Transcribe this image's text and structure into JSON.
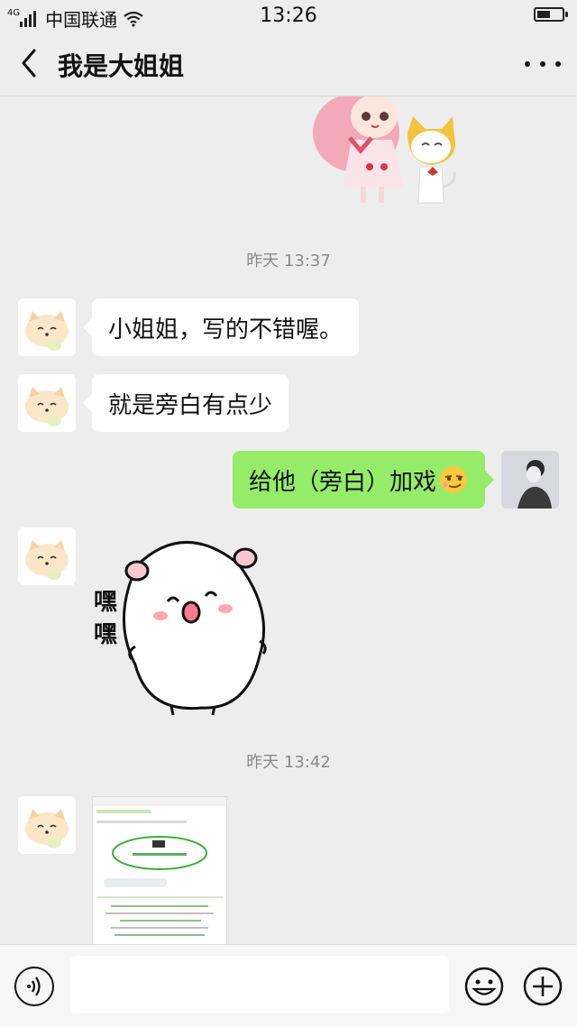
{
  "status": {
    "carrier": "中国联通",
    "signal_label": "4G",
    "time": "13:26",
    "battery_level": 0.55
  },
  "header": {
    "title": "我是大姐姐"
  },
  "chat": {
    "timestamp_1": "昨天 13:37",
    "msg1": "小姐姐，写的不错喔。",
    "msg2": "就是旁白有点少",
    "msg3": "给他（旁白）加戏",
    "sticker_text_1": "嘿",
    "sticker_text_2": "嘿",
    "timestamp_2": "昨天 13:42"
  },
  "icons": {
    "back": "chevron-left-icon",
    "more": "more-dots-icon",
    "voice": "voice-icon",
    "emoji": "smiley-icon",
    "plus": "plus-icon"
  },
  "colors": {
    "background": "#ededed",
    "my_bubble": "#95ec69",
    "their_bubble": "#ffffff",
    "timestamp": "#8a8a8a"
  }
}
